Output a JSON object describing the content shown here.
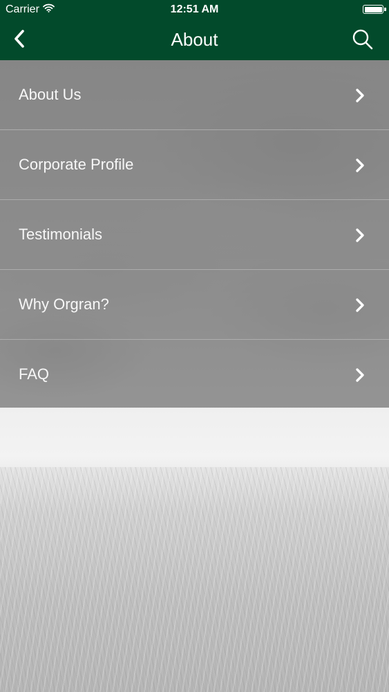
{
  "status_bar": {
    "carrier": "Carrier",
    "time": "12:51 AM",
    "wifi_icon": "wifi-icon",
    "battery_icon": "battery-icon"
  },
  "nav_bar": {
    "title": "About",
    "back_icon": "chevron-left-icon",
    "search_icon": "search-icon",
    "background_color": "#024a2b"
  },
  "menu": {
    "items": [
      {
        "label": "About Us",
        "icon": "chevron-right-icon"
      },
      {
        "label": "Corporate Profile",
        "icon": "chevron-right-icon"
      },
      {
        "label": "Testimonials",
        "icon": "chevron-right-icon"
      },
      {
        "label": "Why Orgran?",
        "icon": "chevron-right-icon"
      },
      {
        "label": "FAQ",
        "icon": "chevron-right-icon"
      }
    ]
  }
}
